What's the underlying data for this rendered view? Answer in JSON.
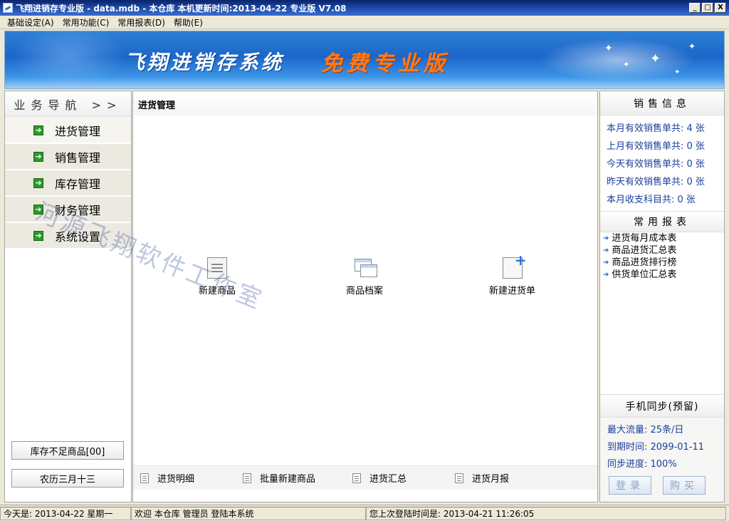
{
  "window": {
    "title": "飞翔进销存专业版 - data.mdb - 本仓库  本机更新时间:2013-04-22 专业版 V7.08",
    "buttons": {
      "minimize": "_",
      "maximize": "□",
      "close": "X"
    }
  },
  "menu": [
    {
      "label": "基础设定(A)"
    },
    {
      "label": "常用功能(C)"
    },
    {
      "label": "常用报表(D)"
    },
    {
      "label": "帮助(E)"
    }
  ],
  "banner": {
    "system_name": "飞翔进销存系统",
    "edition": "免费专业版"
  },
  "nav": {
    "header": "业务导航  >>",
    "items": [
      {
        "label": "进货管理",
        "icon": "green-arrow-icon"
      },
      {
        "label": "销售管理",
        "icon": "green-arrow-icon"
      },
      {
        "label": "库存管理",
        "icon": "green-arrow-icon"
      },
      {
        "label": "财务管理",
        "icon": "green-arrow-icon"
      },
      {
        "label": "系统设置",
        "icon": "green-arrow-icon"
      }
    ],
    "low_stock_button": "库存不足商品[00]",
    "lunar_date": "农历三月十三"
  },
  "center": {
    "title": "进货管理",
    "tools": [
      {
        "label": "新建商品",
        "icon": "document-icon"
      },
      {
        "label": "商品档案",
        "icon": "windows-icon"
      },
      {
        "label": "新建进货单",
        "icon": "new-document-icon"
      }
    ],
    "bottom_links": [
      {
        "label": "进货明细"
      },
      {
        "label": "批量新建商品"
      },
      {
        "label": "进货汇总"
      },
      {
        "label": "进货月报"
      }
    ],
    "watermark": "河源飞翔软件工作室"
  },
  "sales_info": {
    "header": "销售信息",
    "rows": [
      "本月有效销售单共: 4 张",
      "上月有效销售单共: 0 张",
      "今天有效销售单共: 0 张",
      "昨天有效销售单共: 0 张",
      "本月收支科目共: 0 张"
    ]
  },
  "reports": {
    "header": "常用报表",
    "items": [
      "进货每月成本表",
      "商品进货汇总表",
      "商品进货排行榜",
      "供货单位汇总表"
    ]
  },
  "sync": {
    "header": "手机同步(预留)",
    "rows": [
      "最大流量: 25条/日",
      "到期时间: 2099-01-11",
      "同步进度: 100%"
    ],
    "login_button": "登录",
    "buy_button": "购买"
  },
  "status": {
    "today": "今天是: 2013-04-22  星期一",
    "welcome": "欢迎 本仓库 管理员 登陆本系统",
    "last_login": "您上次登陆时间是: 2013-04-21 11:26:05"
  }
}
